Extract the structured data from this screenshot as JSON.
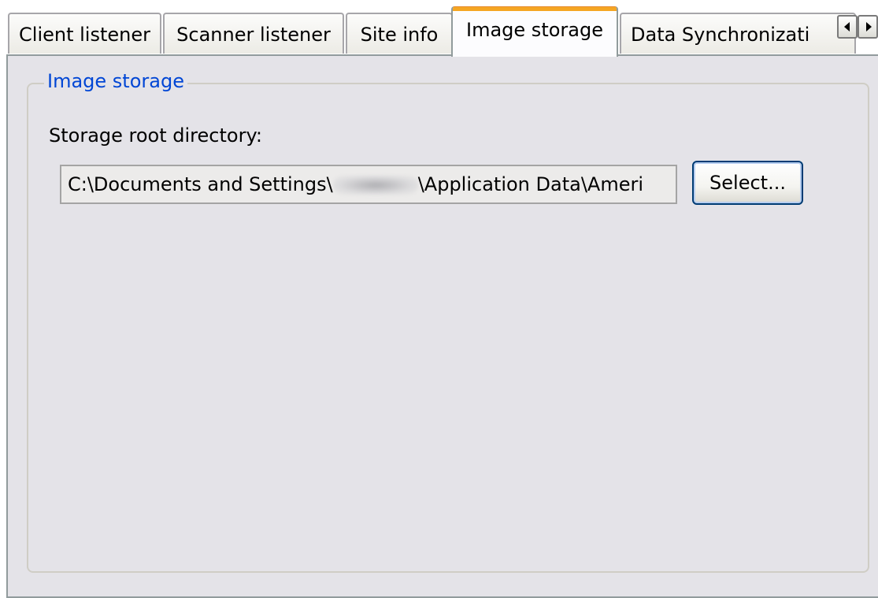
{
  "tabs": [
    {
      "label": "Client listener",
      "active": false
    },
    {
      "label": "Scanner listener",
      "active": false
    },
    {
      "label": "Site info",
      "active": false
    },
    {
      "label": "Image storage",
      "active": true
    },
    {
      "label": "Data Synchronizati",
      "active": false
    }
  ],
  "tab_scroll": {
    "left_icon": "arrow-left",
    "right_icon": "arrow-right"
  },
  "group": {
    "legend": "Image storage",
    "legend_color": "#0046d5"
  },
  "storage": {
    "label": "Storage root directory:",
    "path_prefix": "C:\\Documents and Settings\\",
    "path_suffix": "\\Application Data\\Ameri",
    "select_label": "Select..."
  },
  "colors": {
    "active_tab_accent": "#f5a623",
    "page_background": "#e4e3e8"
  }
}
